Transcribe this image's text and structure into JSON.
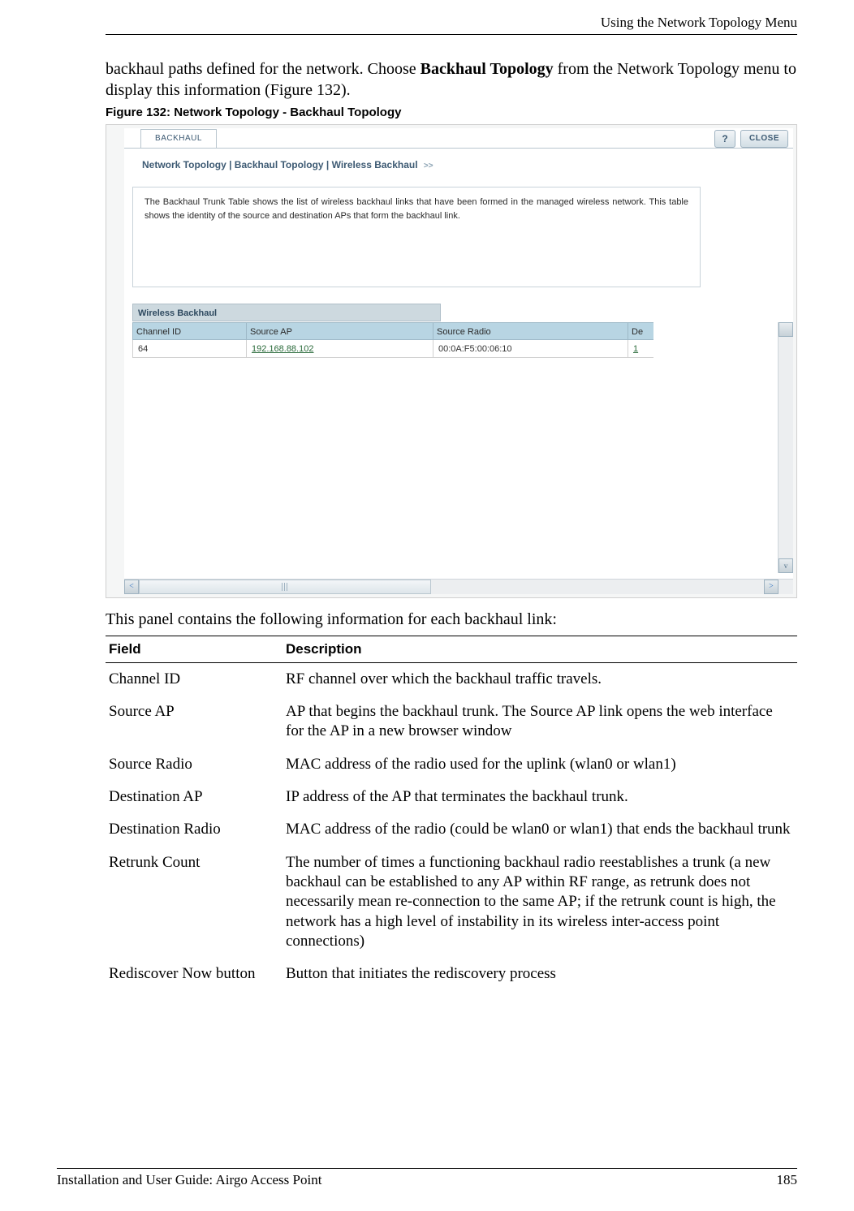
{
  "header_right": "Using the Network Topology Menu",
  "para1_a": "backhaul paths defined for the network. Choose ",
  "para1_bold": "Backhaul Topology",
  "para1_b": " from the Network Topology menu to display this information (Figure 132).",
  "figcaption": "Figure 132:    Network Topology - Backhaul Topology",
  "screenshot": {
    "tab": "BACKHAUL",
    "help": "?",
    "close": "CLOSE",
    "breadcrumb": "Network Topology | Backhaul Topology | Wireless Backhaul",
    "crumb_arrow": ">>",
    "description": "The Backhaul Trunk Table shows the list of wireless backhaul links that have been formed in the managed wireless network. This table shows the identity of the source and destination APs that form the backhaul link.",
    "section_title": "Wireless Backhaul",
    "columns": {
      "c1": "Channel ID",
      "c2": "Source AP",
      "c3": "Source Radio",
      "c4": "De"
    },
    "row": {
      "c1": "64",
      "c2": "192.168.88.102",
      "c3": "00:0A:F5:00:06:10",
      "c4": "1"
    }
  },
  "para2": "This panel contains the following information for each backhaul link:",
  "table_head": {
    "f": "Field",
    "d": "Description"
  },
  "rows": [
    {
      "f": "Channel ID",
      "d": "RF channel over which the backhaul traffic travels."
    },
    {
      "f": "Source AP",
      "d": "AP that begins the backhaul trunk. The Source AP link opens the web interface for the AP in a new browser window"
    },
    {
      "f": "Source Radio",
      "d": "MAC address of the radio used for the uplink (wlan0 or wlan1)"
    },
    {
      "f": "Destination AP",
      "d": "IP address of the AP that terminates the backhaul trunk."
    },
    {
      "f": "Destination Radio",
      "d": "MAC address of the radio (could be wlan0 or wlan1) that ends the backhaul trunk"
    },
    {
      "f": "Retrunk Count",
      "d": "The number of times a functioning backhaul radio reestablishes a trunk (a new backhaul can be established to any AP within RF range, as retrunk does not necessarily mean re-connection to the same AP; if the retrunk count is high, the network has a high level of instability in its wireless inter-access point connections)"
    },
    {
      "f": "Rediscover Now button",
      "d": "Button that initiates the rediscovery process"
    }
  ],
  "footer_left": "Installation and User Guide: Airgo Access Point",
  "footer_right": "185"
}
